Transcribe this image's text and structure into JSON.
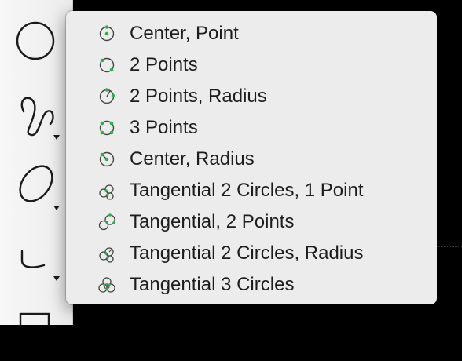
{
  "menu": {
    "items": [
      {
        "label": "Center, Point",
        "icon": "circle-center-point-icon"
      },
      {
        "label": "2 Points",
        "icon": "circle-2-points-icon"
      },
      {
        "label": "2 Points, Radius",
        "icon": "circle-2-points-radius-icon"
      },
      {
        "label": "3 Points",
        "icon": "circle-3-points-icon"
      },
      {
        "label": "Center, Radius",
        "icon": "circle-center-radius-icon"
      },
      {
        "label": "Tangential 2 Circles, 1 Point",
        "icon": "tangential-2-circles-1-point-icon"
      },
      {
        "label": "Tangential, 2 Points",
        "icon": "tangential-2-points-icon"
      },
      {
        "label": "Tangential 2 Circles, Radius",
        "icon": "tangential-2-circles-radius-icon"
      },
      {
        "label": "Tangential 3 Circles",
        "icon": "tangential-3-circles-icon"
      }
    ]
  },
  "toolbar": {
    "tools": [
      "circle-tool-icon",
      "spline-tool-icon",
      "ellipse-tool-icon",
      "arc-tool-icon",
      "rectangle-tool-icon"
    ]
  },
  "colors": {
    "accent_point": "#2db04a",
    "menu_bg": "#ececec",
    "text": "#1d1d1d"
  }
}
